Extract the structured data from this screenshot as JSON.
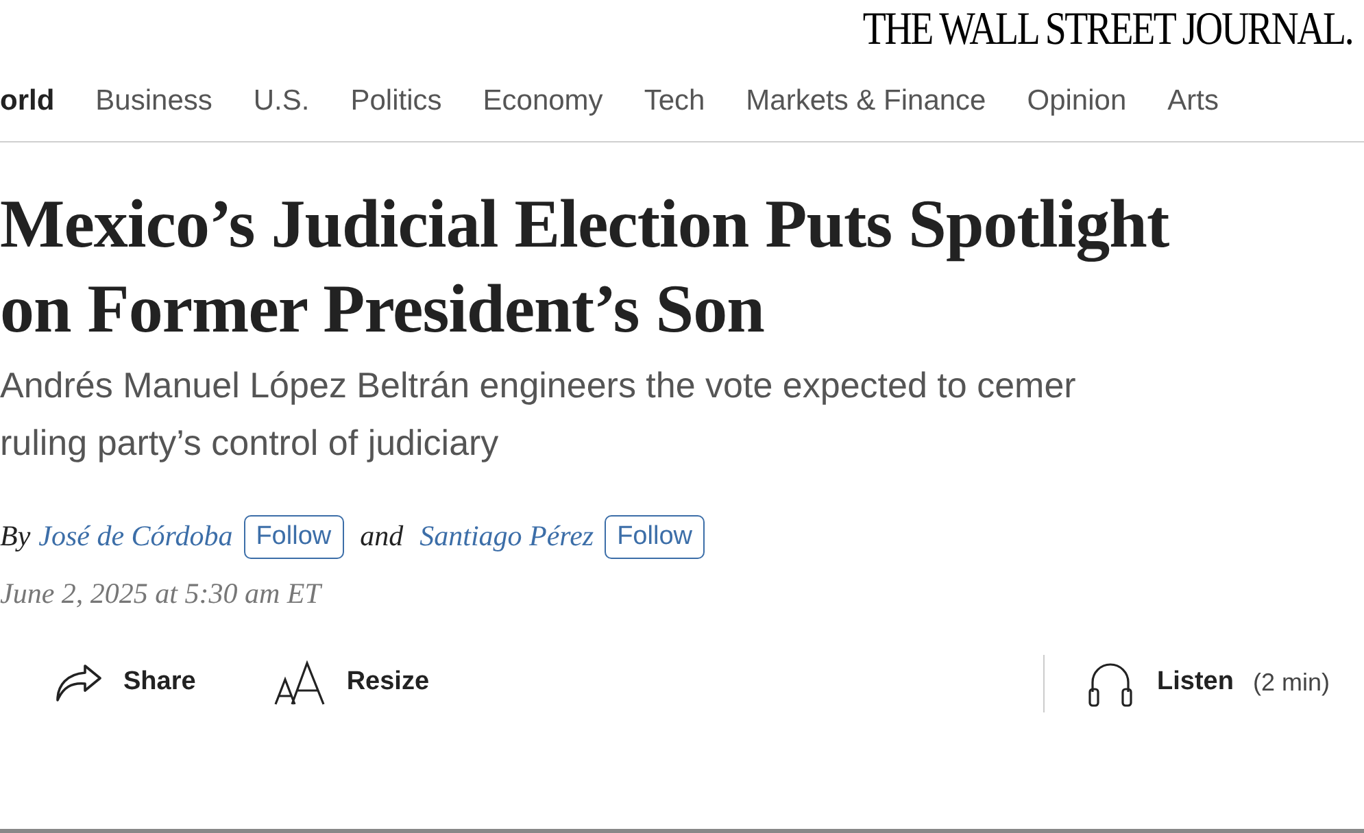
{
  "masthead": {
    "logo": "THE WALL STREET JOURNAL."
  },
  "nav": [
    {
      "label": "orld",
      "selected": true
    },
    {
      "label": "Business",
      "selected": false
    },
    {
      "label": "U.S.",
      "selected": false
    },
    {
      "label": "Politics",
      "selected": false
    },
    {
      "label": "Economy",
      "selected": false
    },
    {
      "label": "Tech",
      "selected": false
    },
    {
      "label": "Markets & Finance",
      "selected": false
    },
    {
      "label": "Opinion",
      "selected": false
    },
    {
      "label": "Arts",
      "selected": false
    }
  ],
  "article": {
    "headline": "Mexico’s Judicial Election Puts Spotlight on Former President’s Son",
    "dek_lines": [
      "Andrés Manuel López Beltrán engineers the vote expected to cemer",
      "ruling party’s control of judiciary"
    ],
    "byline": {
      "by": "By",
      "authors": [
        {
          "name": "José de Córdoba",
          "follow": "Follow"
        },
        {
          "name": "Santiago Pérez",
          "follow": "Follow"
        }
      ],
      "joiner": "and"
    },
    "date": "June 2, 2025 at 5:30 am ET"
  },
  "toolbar": [
    {
      "kind": "share",
      "label": "Share"
    },
    {
      "kind": "resize",
      "label": "Resize"
    }
  ],
  "listen": {
    "label": "Listen",
    "duration": "(2 min)"
  }
}
